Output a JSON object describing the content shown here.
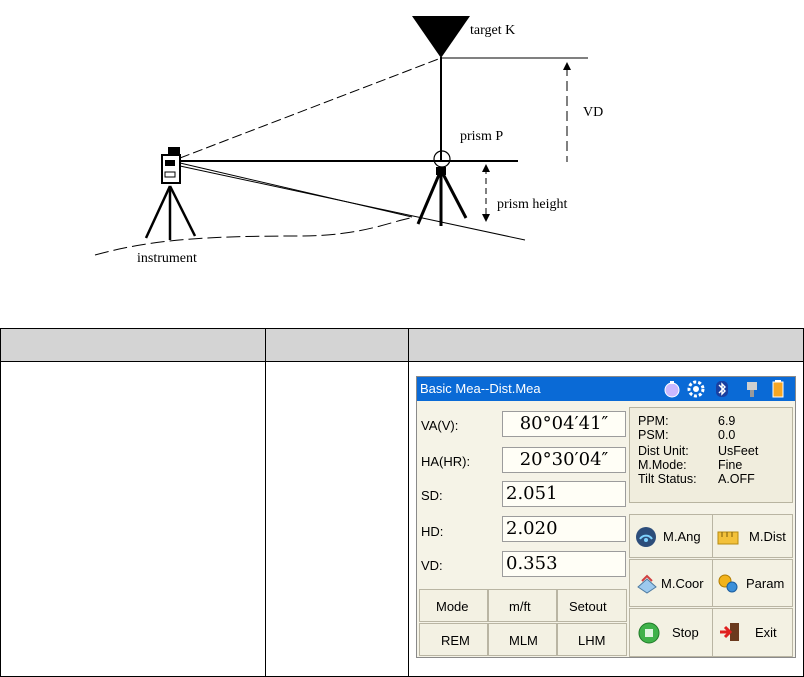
{
  "diagram": {
    "label_target": "target K",
    "label_vd": "VD",
    "label_prism": "prism P",
    "label_prism_height": "prism height",
    "label_instrument": "instrument"
  },
  "device": {
    "title": "Basic Mea--Dist.Mea",
    "fields": {
      "va_label": "VA(V):",
      "va_value": "80°04′41″",
      "ha_label": "HA(HR):",
      "ha_value": "20°30′04″",
      "sd_label": "SD:",
      "sd_value": "2.051",
      "hd_label": "HD:",
      "hd_value": "2.020",
      "vd_label": "VD:",
      "vd_value": "0.353"
    },
    "info": {
      "ppm_label": "PPM:",
      "ppm_value": "6.9",
      "psm_label": "PSM:",
      "psm_value": "0.0",
      "unit_label": "Dist Unit:",
      "unit_value": "UsFeet",
      "mode_label": "M.Mode:",
      "mode_value": "Fine",
      "tilt_label": "Tilt Status:",
      "tilt_value": "A.OFF"
    },
    "buttons": {
      "m_ang": "M.Ang",
      "m_dist": "M.Dist",
      "m_coor": "M.Coor",
      "param": "Param",
      "stop": "Stop",
      "exit": "Exit",
      "mode": "Mode",
      "mft": "m/ft",
      "setout": "Setout",
      "rem": "REM",
      "mlm": "MLM",
      "lhm": "LHM"
    },
    "colors": {
      "titlebar": "#0a6ad6",
      "panel": "#f5f3e7"
    }
  }
}
